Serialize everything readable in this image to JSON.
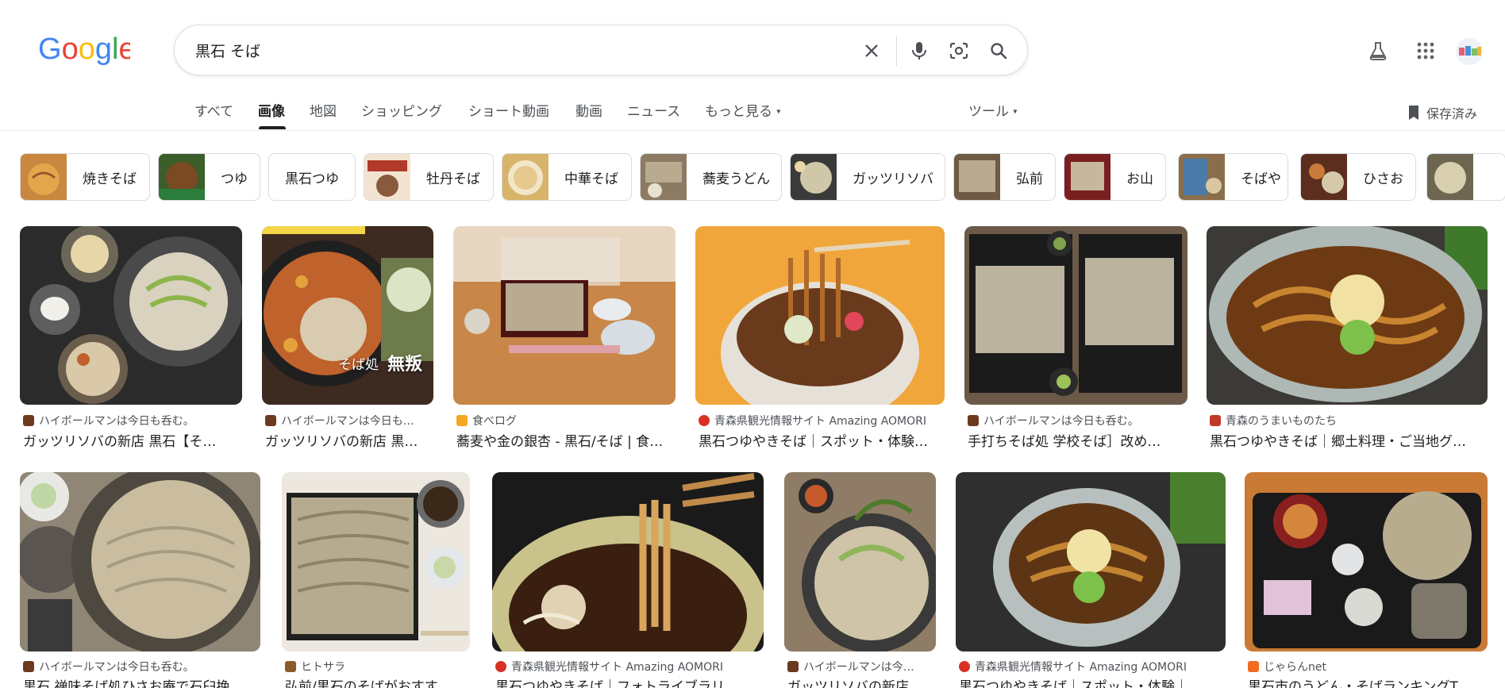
{
  "search": {
    "query": "黒石 そば"
  },
  "tabs": [
    {
      "label": "すべて"
    },
    {
      "label": "画像"
    },
    {
      "label": "地図"
    },
    {
      "label": "ショッピング"
    },
    {
      "label": "ショート動画"
    },
    {
      "label": "動画"
    },
    {
      "label": "ニュース"
    },
    {
      "label": "もっと見る"
    }
  ],
  "tools_label": "ツール",
  "saved_label": "保存済み",
  "chips": [
    {
      "label": "焼きそば"
    },
    {
      "label": "つゆ"
    },
    {
      "label": "黒石つゆ"
    },
    {
      "label": "牡丹そば"
    },
    {
      "label": "中華そば"
    },
    {
      "label": "蕎麦うどん"
    },
    {
      "label": "ガッツリソバ"
    },
    {
      "label": "弘前"
    },
    {
      "label": "お山"
    },
    {
      "label": "そばや"
    },
    {
      "label": "ひさお"
    }
  ],
  "results_row1": [
    {
      "source": "ハイボールマンは今日も呑む。",
      "title": "ガッツリソバの新店 黒石【そ…",
      "fav_color": "#6b3a1f"
    },
    {
      "source": "ハイボールマンは今日も…",
      "title": "ガッツリソバの新店 黒…",
      "fav_color": "#6b3a1f",
      "overlay1": "そば処",
      "overlay2": "無叛"
    },
    {
      "source": "食べログ",
      "title": "蕎麦や金の銀杏 - 黒石/そば | 食…",
      "fav_color": "#f5a623"
    },
    {
      "source": "青森県観光情報サイト Amazing AOMORI",
      "title": "黒石つゆやきそば｜スポット・体験…",
      "fav_color": "#d93025"
    },
    {
      "source": "ハイボールマンは今日も呑む。",
      "title": "手打ちそば処 学校そば］改め…",
      "fav_color": "#6b3a1f"
    },
    {
      "source": "青森のうまいものたち",
      "title": "黒石つゆやきそば｜郷土料理・ご当地グ…",
      "fav_color": "#c0392b"
    }
  ],
  "results_row2": [
    {
      "source": "ハイボールマンは今日も呑む。",
      "title": "黒石 禅味そば処ひさお庵で石臼挽…",
      "fav_color": "#6b3a1f"
    },
    {
      "source": "ヒトサラ",
      "title": "弘前/黒石のそばがおすす…",
      "fav_color": "#8b5a2b"
    },
    {
      "source": "青森県観光情報サイト Amazing AOMORI",
      "title": "黒石つゆやきそば｜フォトライブラリ…",
      "fav_color": "#d93025"
    },
    {
      "source": "ハイボールマンは今…",
      "title": "ガッツリソバの新店…",
      "fav_color": "#6b3a1f"
    },
    {
      "source": "青森県観光情報サイト Amazing AOMORI",
      "title": "黒石つゆやきそば｜スポット・体験｜…",
      "fav_color": "#d93025"
    },
    {
      "source": "じゃらんnet",
      "title": "黒石市のうどん・そばランキングT…",
      "fav_color": "#f26b21"
    }
  ]
}
